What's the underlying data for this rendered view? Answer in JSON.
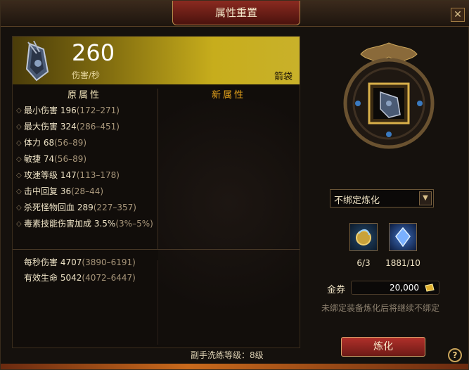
{
  "window": {
    "title": "属性重置",
    "close_label": "✕"
  },
  "item": {
    "dps": "260",
    "dps_label": "伤害/秒",
    "type": "箭袋"
  },
  "columns": {
    "old": "原属性",
    "new": "新属性"
  },
  "stats": [
    {
      "name": "最小伤害",
      "value": "196",
      "range": "(172–271)"
    },
    {
      "name": "最大伤害",
      "value": "324",
      "range": "(286–451)"
    },
    {
      "name": "体力",
      "value": "68",
      "range": "(56–89)"
    },
    {
      "name": "敏捷",
      "value": "74",
      "range": "(56–89)"
    },
    {
      "name": "攻速等级",
      "value": "147",
      "range": "(113–178)"
    },
    {
      "name": "击中回复",
      "value": "36",
      "range": "(28–44)"
    },
    {
      "name": "杀死怪物回血",
      "value": "289",
      "range": "(227–357)"
    },
    {
      "name": "毒素技能伤害加成",
      "value": "3.5%",
      "range": "(3%–5%)"
    }
  ],
  "summary": {
    "dps_label": "每秒伤害",
    "dps_value": "4707",
    "dps_range": "(3890–6191)",
    "life_label": "有效生命",
    "life_value": "5042",
    "life_range": "(4072–6447)"
  },
  "footer": {
    "level_text": "副手洗练等级：8级"
  },
  "refine": {
    "mode": "不绑定炼化",
    "materials": [
      {
        "icon": "gold-orb-icon",
        "count": "6/3"
      },
      {
        "icon": "blue-crystal-icon",
        "count": "1881/10"
      }
    ],
    "gold_label": "金券",
    "gold_value": "20,000",
    "note": "未绑定装备炼化后将继续不绑定",
    "button": "炼化",
    "help": "?"
  }
}
